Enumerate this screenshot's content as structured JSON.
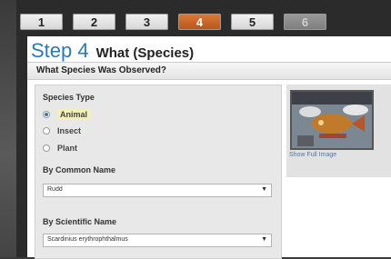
{
  "steps": [
    {
      "label": "1"
    },
    {
      "label": "2"
    },
    {
      "label": "3"
    },
    {
      "label": "4",
      "state": "active"
    },
    {
      "label": "5"
    },
    {
      "label": "6",
      "state": "disabled"
    }
  ],
  "header": {
    "step_label": "Step 4",
    "step_title": "What (Species)",
    "question": "What Species Was Observed?"
  },
  "species_type": {
    "label": "Species Type",
    "options": [
      {
        "label": "Animal",
        "selected": true
      },
      {
        "label": "Insect",
        "selected": false
      },
      {
        "label": "Plant",
        "selected": false
      }
    ]
  },
  "common_name": {
    "label": "By Common Name",
    "value": "Rudd"
  },
  "scientific_name": {
    "label": "By Scientific Name",
    "value": "Scardinius erythrophthalmus"
  },
  "image_panel": {
    "link_label": "Show Full Image",
    "icon": "fish-photo"
  },
  "colors": {
    "accent": "#2a7ab8",
    "active_step": "#c8652a"
  }
}
